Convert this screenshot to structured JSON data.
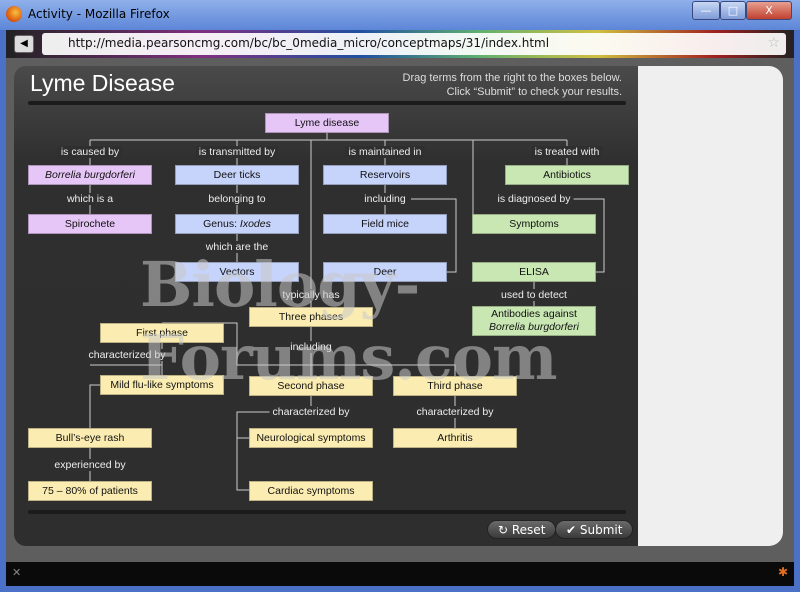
{
  "window": {
    "title": "Activity - Mozilla Firefox",
    "minimize": "—",
    "maximize": "□",
    "close": "X"
  },
  "browser": {
    "url": "http://media.pearsoncmg.com/bc/bc_0media_micro/conceptmaps/31/index.html",
    "back_icon": "back-icon",
    "bookmark_icon": "star-icon"
  },
  "page": {
    "title": "Lyme Disease",
    "instruction1": "Drag terms from the right to the boxes below.",
    "instruction2": "Click “Submit” to check your results."
  },
  "boxes": {
    "lyme": "Lyme disease",
    "borrelia": "Borrelia burgdorferi",
    "deer_ticks": "Deer ticks",
    "reservoirs": "Reservoirs",
    "antibiotics": "Antibiotics",
    "spirochete": "Spirochete",
    "genus": "Genus: ",
    "genus_italic": "Ixodes",
    "field_mice": "Field mice",
    "symptoms": "Symptoms",
    "vectors": "Vectors",
    "deer": "Deer",
    "elisa": "ELISA",
    "three_phases": "Three phases",
    "antibodies1": "Antibodies against",
    "antibodies2": "Borrelia burgdorferi",
    "first_phase": "First phase",
    "mild": "Mild flu-like symptoms",
    "second_phase": "Second phase",
    "third_phase": "Third phase",
    "bullseye": "Bull’s-eye rash",
    "neuro": "Neurological symptoms",
    "arthritis": "Arthritis",
    "percent": "75 – 80% of patients",
    "cardiac": "Cardiac symptoms"
  },
  "labels": {
    "caused": "is caused by",
    "transmitted": "is transmitted by",
    "maintained": "is maintained in",
    "treated": "is treated with",
    "which_is": "which is a",
    "belonging": "belonging to",
    "including1": "including",
    "diagnosed": "is diagnosed by",
    "which_are": "which are the",
    "typically": "typically has",
    "used": "used to detect",
    "including2": "including",
    "char1": "characterized by",
    "char2": "characterized by",
    "char3": "characterized by",
    "experienced": "experienced by"
  },
  "buttons": {
    "reset": "Reset",
    "submit": "Submit"
  },
  "watermark": "Biology-Forums.com",
  "colors": {
    "pink": "#e6c6f6",
    "blue": "#c6d3fa",
    "green": "#c9e7b3",
    "yellow": "#fbedb2"
  }
}
